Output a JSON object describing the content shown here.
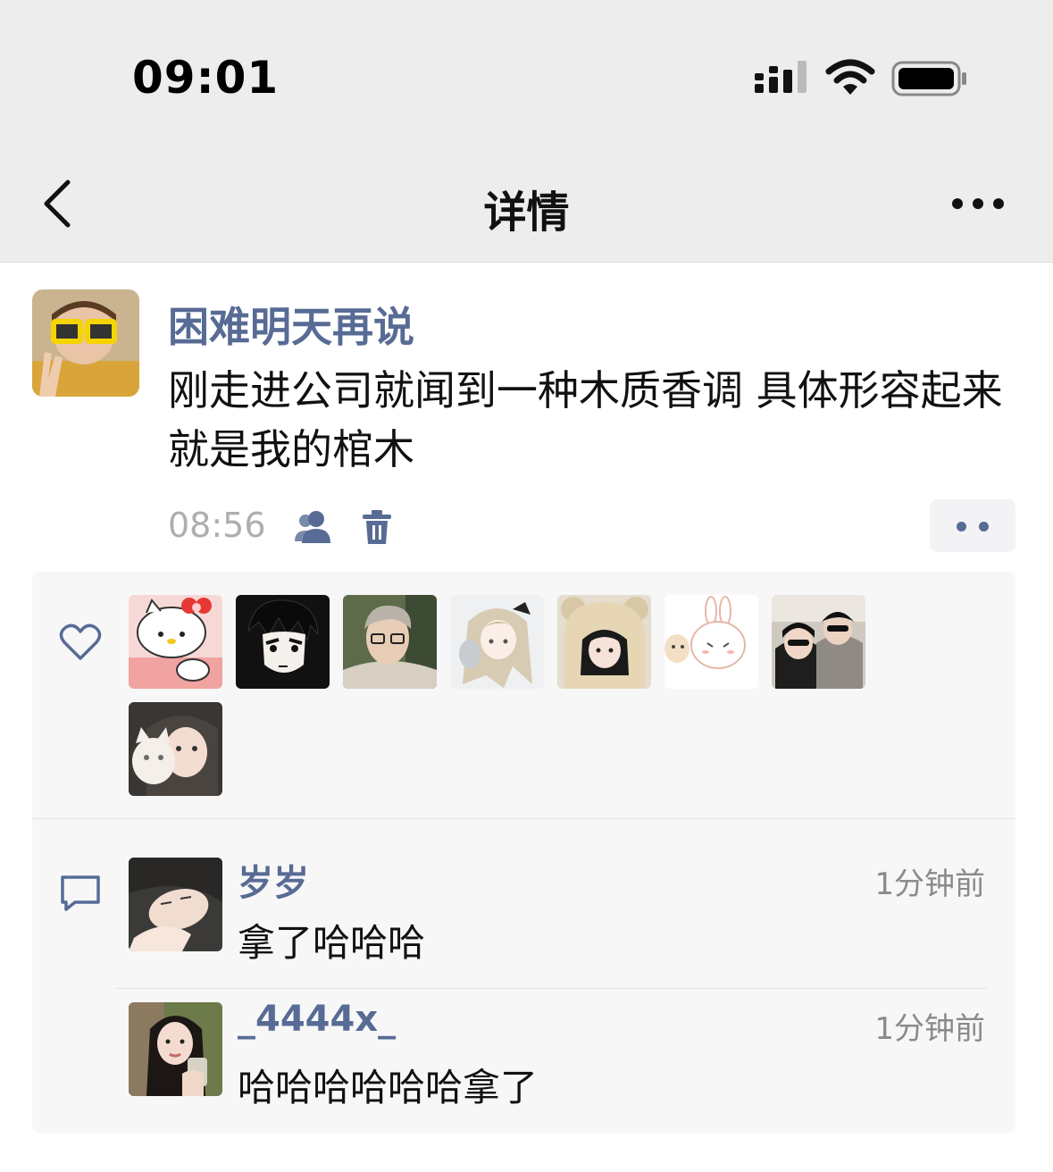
{
  "status_bar": {
    "time": "09:01"
  },
  "nav": {
    "title": "详情"
  },
  "post": {
    "author": "困难明天再说",
    "text": "刚走进公司就闻到一种木质香调 具体形容起来就是我的棺木",
    "time": "08:56"
  },
  "likes": {
    "avatars": [
      "hello-kitty-avatar",
      "anime-boy-avatar",
      "man-glasses-avatar",
      "anime-girl-avatar",
      "bear-hat-girl-avatar",
      "bunny-avatar",
      "couple-sunglasses-avatar",
      "girl-cat-avatar"
    ]
  },
  "comments": [
    {
      "name": "岁岁",
      "time": "1分钟前",
      "text": "拿了哈哈哈"
    },
    {
      "name": "_4444x_",
      "time": "1分钟前",
      "text": "哈哈哈哈哈哈拿了"
    }
  ],
  "colors": {
    "link": "#576b95",
    "nav_bg": "#ededed",
    "panel_bg": "#f7f7f7"
  }
}
